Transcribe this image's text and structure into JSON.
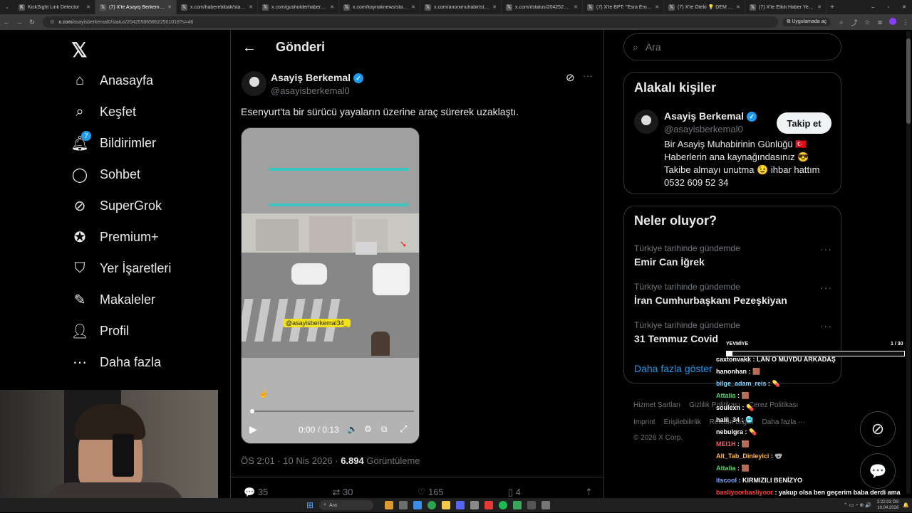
{
  "browser": {
    "tabs": [
      {
        "title": "KickSight Link Detector",
        "active": false
      },
      {
        "title": "(7) X'te Asayiş Berkemal: \"Ese",
        "active": true
      },
      {
        "title": "x.com/haberebibak/status/20",
        "active": false
      },
      {
        "title": "x.com/gusholderhaber/status",
        "active": false
      },
      {
        "title": "x.com/kaynaknews/status/20",
        "active": false
      },
      {
        "title": "x.com/anonimuhabir/status/2",
        "active": false
      },
      {
        "title": "x.com/i/status/204252749753",
        "active": false
      },
      {
        "title": "(7) X'te BPT: \"Esra Erol'da epi",
        "active": false
      },
      {
        "title": "(7) X'te Öteki 💡 DEM Partili",
        "active": false
      },
      {
        "title": "(7) X'te Etkili Haber Yeni Saylı",
        "active": false
      }
    ],
    "url_domain": "x.com",
    "url_path": "/asayisberkemal0/status/2042558658622501018?s=46",
    "open_in_app": "Uygulamada aç"
  },
  "nav": {
    "items": [
      {
        "label": "Anasayfa",
        "icon": "home-icon"
      },
      {
        "label": "Keşfet",
        "icon": "search-icon"
      },
      {
        "label": "Bildirimler",
        "icon": "bell-icon",
        "badge": "7"
      },
      {
        "label": "Sohbet",
        "icon": "chat-icon"
      },
      {
        "label": "SuperGrok",
        "icon": "grok-icon"
      },
      {
        "label": "Premium+",
        "icon": "premium-icon"
      },
      {
        "label": "Yer İşaretleri",
        "icon": "bookmark-icon"
      },
      {
        "label": "Makaleler",
        "icon": "article-icon"
      },
      {
        "label": "Profil",
        "icon": "profile-icon"
      },
      {
        "label": "Daha fazla",
        "icon": "more-icon"
      }
    ]
  },
  "post": {
    "header_title": "Gönderi",
    "author_name": "Asayiş Berkemal",
    "author_handle": "@asayisberkemal0",
    "text": "Esenyurt'ta bir sürücü yayaların üzerine araç sürerek uzaklaştı.",
    "video_watermark": "@asayisberkemal34_",
    "video_time": "0:00 / 0:13",
    "timestamp": "ÖS 2:01 · 10 Nis 2026 · ",
    "views": "6.894",
    "views_label": "Görüntüleme",
    "replies": "35",
    "reposts": "30",
    "likes": "165",
    "bookmarks": "4"
  },
  "search": {
    "placeholder": "Ara"
  },
  "related": {
    "title": "Alakalı kişiler",
    "name": "Asayiş Berkemal",
    "handle": "@asayisberkemal0",
    "follow_label": "Takip et",
    "bio_lines": [
      "Bir Asayiş Muhabirinin Günlüğü 🇹🇷",
      "Haberlerin ana kaynağındasınız 😎",
      "Takibe almayı unutma 😉 ihbar hattım",
      "0532 609 52 34"
    ]
  },
  "trends": {
    "title": "Neler oluyor?",
    "items": [
      {
        "category": "Türkiye tarihinde gündemde",
        "name": "Emir Can İğrek"
      },
      {
        "category": "Türkiye tarihinde gündemde",
        "name": "İran Cumhurbaşkanı Pezeşkiyan"
      },
      {
        "category": "Türkiye tarihinde gündemde",
        "name": "31 Temmuz Covid"
      }
    ],
    "show_more": "Daha fazla göster"
  },
  "footer": {
    "links": [
      "Hizmet Şartları",
      "Gizlilik Politikası",
      "Çerez Politikası",
      "Imprint",
      "Erişilebilirlik",
      "Reklam bilgisi",
      "Daha fazla ···"
    ],
    "copyright": "© 2026 X Corp."
  },
  "overlay": {
    "yevmiye_label": "YEVMİYE",
    "yevmiye_count": "1 / 30",
    "yevmiye_progress": 0.033,
    "chat": [
      {
        "user": "caxtonvakk",
        "msg": "LAN O MUYDU ARKADAŞ",
        "color": "#ffffff"
      },
      {
        "user": "hanonhan",
        "msg": "🟫",
        "color": "#ffffff"
      },
      {
        "user": "bilge_adam_reis",
        "msg": "💊",
        "color": "#7fd3ff"
      },
      {
        "user": "Attalia",
        "msg": "🟫",
        "color": "#5bd26b"
      },
      {
        "user": "soulexn",
        "msg": "💊",
        "color": "#ffffff"
      },
      {
        "user": "halil_34",
        "msg": "🥶",
        "color": "#ffffff"
      },
      {
        "user": "nebulgra",
        "msg": "💊",
        "color": "#ffffff"
      },
      {
        "user": "MEI1H",
        "msg": "🟫",
        "color": "#ff5a5a"
      },
      {
        "user": "Alt_Tab_Dinleyici",
        "msg": "🐨",
        "color": "#ffb84d"
      },
      {
        "user": "Attalia",
        "msg": "🟫",
        "color": "#5bd26b"
      },
      {
        "user": "itscool",
        "msg": "KIRMIZILI BENİZYO",
        "color": "#7fa8ff"
      },
      {
        "user": "basliyoorbasliyoor",
        "msg": "yakup olsa ben geçerim baba derdi ama",
        "color": "#ff4040"
      }
    ]
  },
  "taskbar": {
    "search_placeholder": "Ara",
    "time": "2:22:03 ÖS",
    "date": "10.04.2026"
  }
}
